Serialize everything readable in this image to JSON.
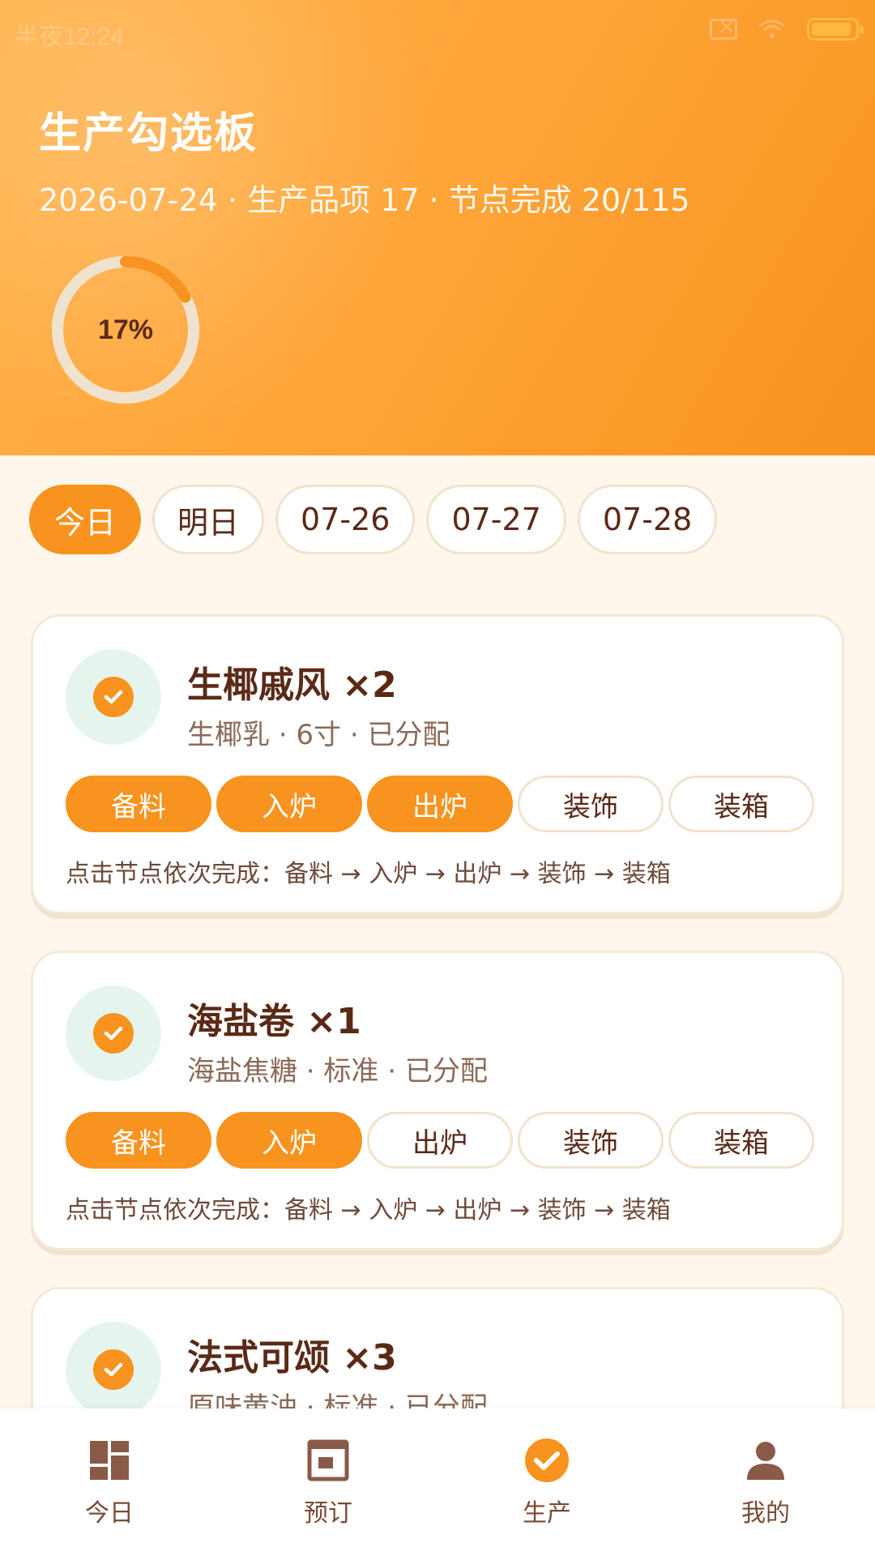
{
  "status": {
    "time": "半夜12:24"
  },
  "header": {
    "title": "生产勾选板",
    "subtitle": "2026-07-24 · 生产品项 17 · 节点完成 20/115",
    "progress_percent": 17,
    "progress_label": "17%"
  },
  "colors": {
    "accent": "#F7931E",
    "text_dark": "#5A2A17",
    "check_bg": "#E6F4EE"
  },
  "tabs": [
    {
      "label": "今日",
      "active": true
    },
    {
      "label": "明日",
      "active": false
    },
    {
      "label": "07-26",
      "active": false
    },
    {
      "label": "07-27",
      "active": false
    },
    {
      "label": "07-28",
      "active": false
    }
  ],
  "cards": [
    {
      "name": "生椰戚风 ×2",
      "meta": "生椰乳 · 6寸 · 已分配",
      "steps": [
        {
          "label": "备料",
          "done": true
        },
        {
          "label": "入炉",
          "done": true
        },
        {
          "label": "出炉",
          "done": true
        },
        {
          "label": "装饰",
          "done": false
        },
        {
          "label": "装箱",
          "done": false
        }
      ],
      "hint": "点击节点依次完成：备料 → 入炉 → 出炉 → 装饰 → 装箱"
    },
    {
      "name": "海盐卷 ×1",
      "meta": "海盐焦糖 · 标准 · 已分配",
      "steps": [
        {
          "label": "备料",
          "done": true
        },
        {
          "label": "入炉",
          "done": true
        },
        {
          "label": "出炉",
          "done": false
        },
        {
          "label": "装饰",
          "done": false
        },
        {
          "label": "装箱",
          "done": false
        }
      ],
      "hint": "点击节点依次完成：备料 → 入炉 → 出炉 → 装饰 → 装箱"
    },
    {
      "name": "法式可颂 ×3",
      "meta": "原味黄油 · 标准 · 已分配"
    }
  ],
  "nav": [
    {
      "label": "今日",
      "icon": "dashboard-icon",
      "active": false
    },
    {
      "label": "预订",
      "icon": "calendar-icon",
      "active": false
    },
    {
      "label": "生产",
      "icon": "check-circle-icon",
      "active": true
    },
    {
      "label": "我的",
      "icon": "user-icon",
      "active": false
    }
  ]
}
